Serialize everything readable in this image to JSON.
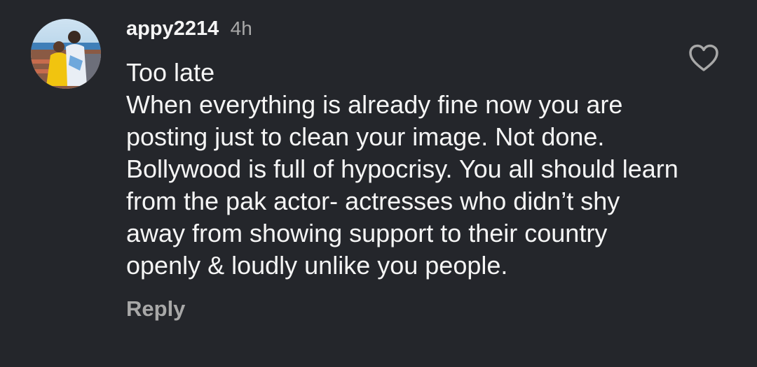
{
  "comment": {
    "username": "appy2214",
    "timestamp": "4h",
    "lines": [
      "Too late",
      "When everything is already fine now you are posting just to clean your image. Not done. Bollywood is full of hypocrisy. You all should learn from the pak actor- actresses who didn’t shy away from showing support to their country openly & loudly unlike you people."
    ],
    "reply_label": "Reply",
    "like_icon": "heart-outline-icon"
  },
  "colors": {
    "background": "#24262b",
    "text_primary": "#f5f5f5",
    "text_secondary": "#a8a8a8"
  }
}
